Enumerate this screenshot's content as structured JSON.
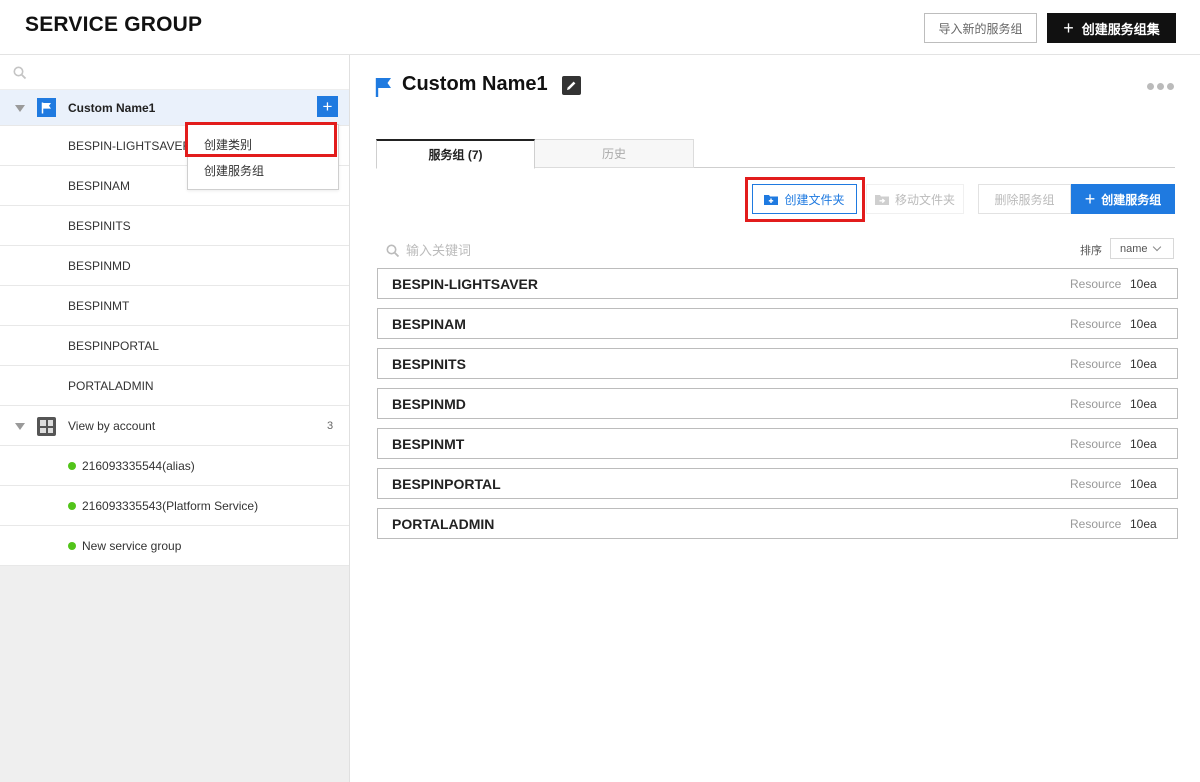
{
  "header": {
    "title": "SERVICE GROUP",
    "import_label": "导入新的服务组",
    "create_set_label": "创建服务组集"
  },
  "sidebar": {
    "root": {
      "label": "Custom Name1"
    },
    "groups": [
      "BESPIN-LIGHTSAVER",
      "BESPINAM",
      "BESPINITS",
      "BESPINMD",
      "BESPINMT",
      "BESPINPORTAL",
      "PORTALADMIN"
    ],
    "account_section": {
      "label": "View by account",
      "count": "3"
    },
    "accounts": [
      "216093335544(alias)",
      "216093335543(Platform Service)",
      "New service group"
    ],
    "status_color": "#52c41a"
  },
  "context_menu": {
    "items": [
      "创建类别",
      "创建服务组"
    ]
  },
  "main": {
    "title": "Custom Name1",
    "tabs": [
      {
        "label": "服务组 (7)",
        "active": true
      },
      {
        "label": "历史",
        "active": false
      }
    ],
    "toolbar": {
      "create_folder": "创建文件夹",
      "move_folder": "移动文件夹",
      "delete_group": "删除服务组",
      "create_group": "创建服务组"
    },
    "search": {
      "placeholder": "输入关键词"
    },
    "sort": {
      "label": "排序",
      "value": "name"
    },
    "resource_label": "Resource",
    "rows": [
      {
        "name": "BESPIN-LIGHTSAVER",
        "count": "10ea"
      },
      {
        "name": "BESPINAM",
        "count": "10ea"
      },
      {
        "name": "BESPINITS",
        "count": "10ea"
      },
      {
        "name": "BESPINMD",
        "count": "10ea"
      },
      {
        "name": "BESPINMT",
        "count": "10ea"
      },
      {
        "name": "BESPINPORTAL",
        "count": "10ea"
      },
      {
        "name": "PORTALADMIN",
        "count": "10ea"
      }
    ]
  },
  "colors": {
    "accent": "#1f7ae0",
    "highlight": "#e21c1c"
  }
}
